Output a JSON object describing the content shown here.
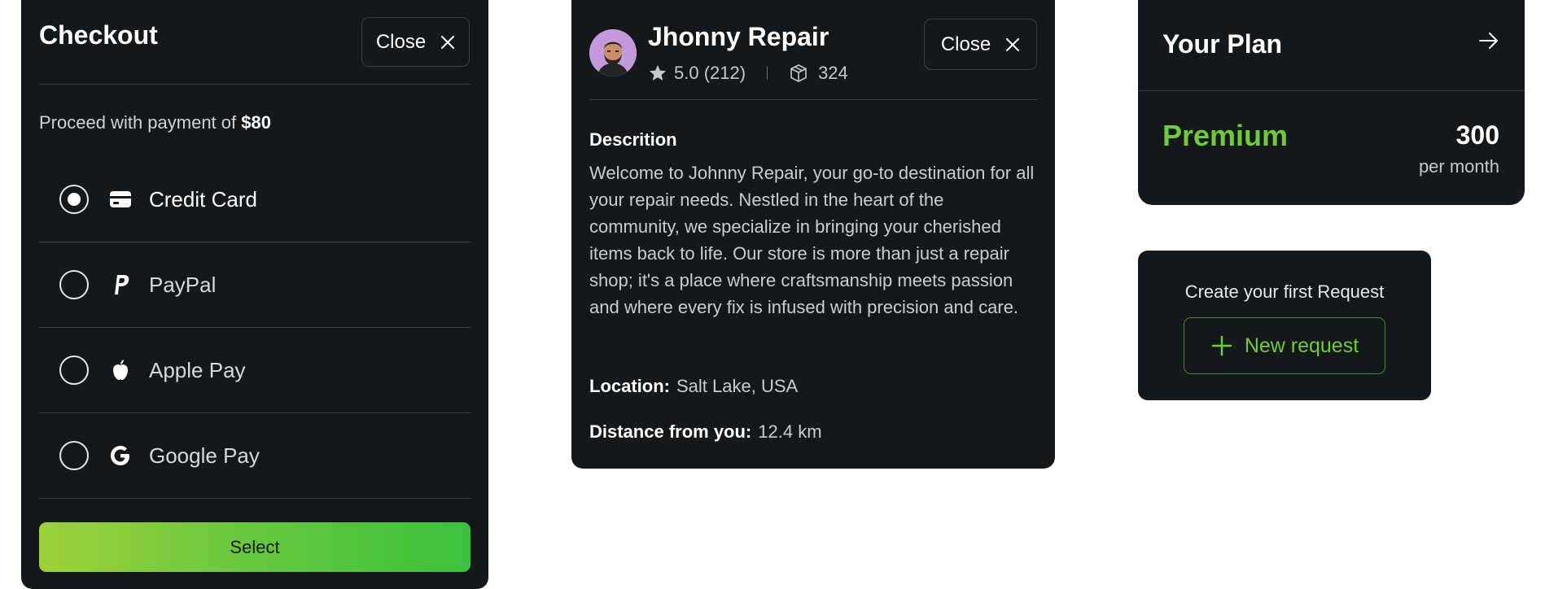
{
  "checkout": {
    "title": "Checkout",
    "close_label": "Close",
    "proceed_text": "Proceed with payment of ",
    "amount": "$80",
    "methods": [
      {
        "label": "Credit Card",
        "icon": "credit-card-icon",
        "selected": true
      },
      {
        "label": "PayPal",
        "icon": "paypal-icon",
        "selected": false
      },
      {
        "label": "Apple Pay",
        "icon": "apple-icon",
        "selected": false
      },
      {
        "label": "Google Pay",
        "icon": "google-icon",
        "selected": false
      }
    ],
    "select_label": "Select",
    "button_gradient": [
      "#9ed13c",
      "#3cc13f"
    ]
  },
  "repair": {
    "name": "Jhonny Repair",
    "rating": "5.0 (212)",
    "orders": "324",
    "close_label": "Close",
    "desc_title": "Descrition",
    "description": "Welcome to Johnny Repair, your go-to destination for all your repair needs. Nestled in the heart of the community, we specialize in bringing your cherished items back to life. Our store is more than just a repair shop; it's a place where craftsmanship meets passion and where every fix is infused with precision and care.",
    "location_label": "Location:",
    "location_value": "Salt Lake, USA",
    "distance_label": "Distance from you:",
    "distance_value": "12.4 km"
  },
  "plan": {
    "title": "Your Plan",
    "tier": "Premium",
    "price": "300",
    "period": "per month",
    "accent": "#6fcb3a"
  },
  "request": {
    "prompt": "Create your first Request",
    "button_label": "New request"
  }
}
